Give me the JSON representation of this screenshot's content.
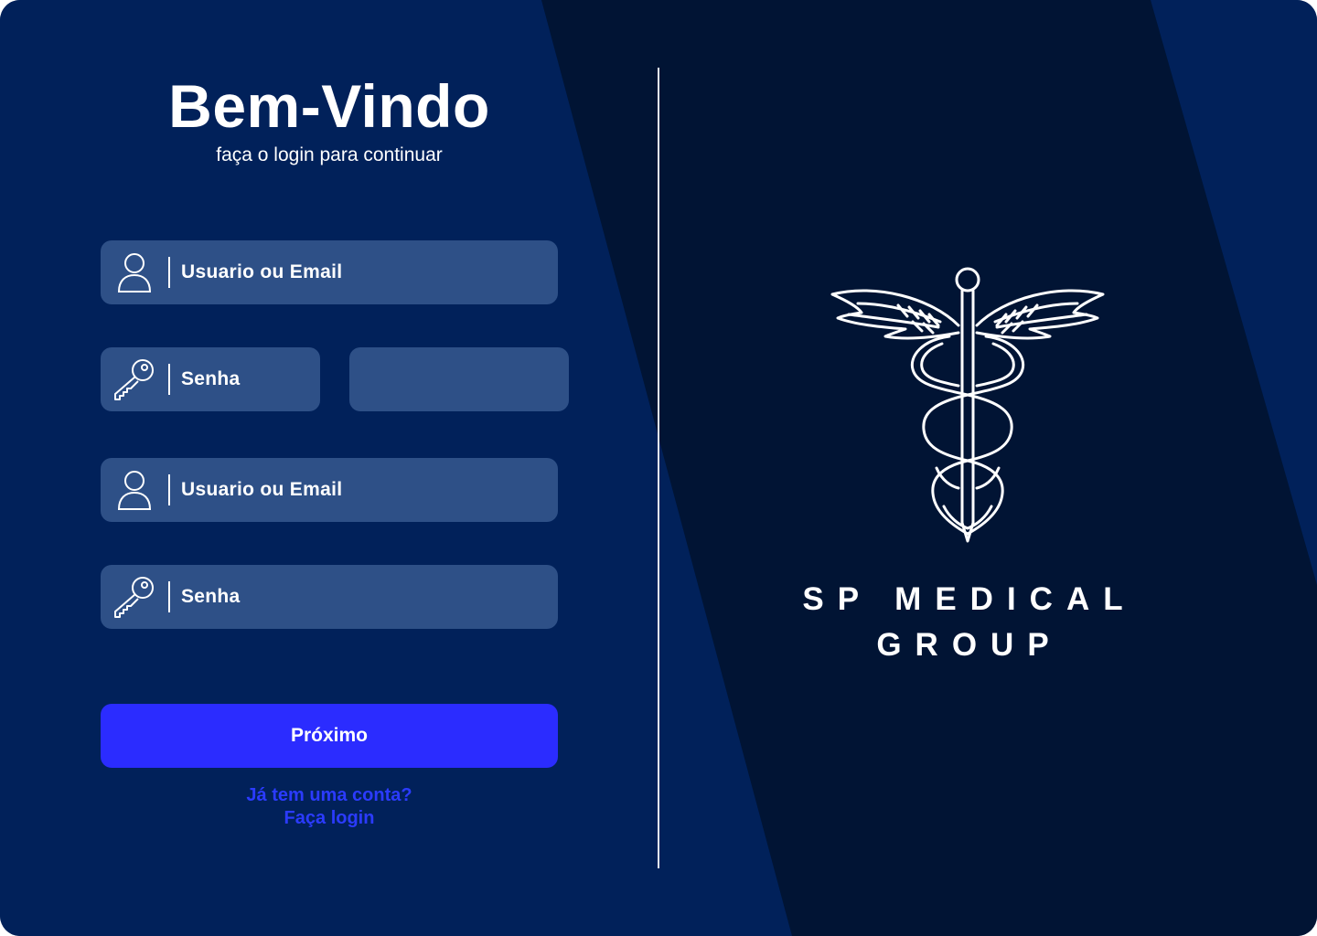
{
  "welcome": {
    "title": "Bem-Vindo",
    "subtitle": "faça o login para continuar"
  },
  "form": {
    "user_field_1": {
      "label": "Usuario ou Email",
      "icon": "user-icon"
    },
    "password_field_1": {
      "label": "Senha",
      "icon": "key-icon"
    },
    "extra_field": {
      "label": ""
    },
    "user_field_2": {
      "label": "Usuario ou Email",
      "icon": "user-icon"
    },
    "password_field_2": {
      "label": "Senha",
      "icon": "key-icon"
    },
    "submit_label": "Próximo"
  },
  "login_link": {
    "question": "Já tem uma conta?",
    "action": "Faça login"
  },
  "brand": {
    "line1": "SP MEDICAL",
    "line2": "GROUP",
    "logo_icon": "caduceus-icon"
  },
  "colors": {
    "panel_blue": "#01215a",
    "dark_navy": "#011434",
    "input_bg": "#2e5087",
    "button_bg": "#2b2cff",
    "link_color": "#2b3bff"
  }
}
